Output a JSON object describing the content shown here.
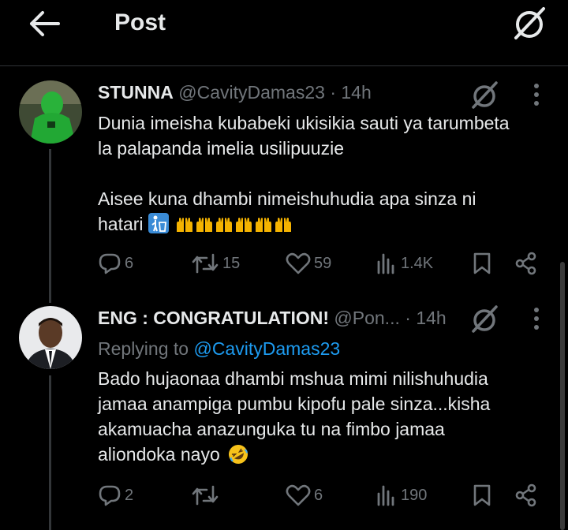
{
  "header": {
    "title": "Post"
  },
  "post": {
    "author_name": "STUNNA",
    "handle": "@CavityDamas23",
    "separator": "·",
    "time": "14h",
    "lines": [
      "Dunia imeisha kubabeki ukisikia sauti ya tarumbeta",
      "la palapanda imelia usilipuuzie"
    ],
    "line3": "Aisee kuna dhambi nimeishuhudia apa sinza ni",
    "line4_text": "hatari",
    "emoji": [
      "litter-in-bin-icon",
      "raising-hands-icon"
    ],
    "stats": {
      "replies": "6",
      "reposts": "15",
      "likes": "59",
      "views": "1.4K"
    }
  },
  "reply": {
    "author_name": "ENG : CONGRATULATION!",
    "handle": "@Pon...",
    "separator": "·",
    "time": "14h",
    "replying_prefix": "Replying to",
    "replying_handle": "@CavityDamas23",
    "lines": [
      "Bado hujaonaa dhambi mshua mimi nilishuhudia",
      "jamaa anampiga pumbu kipofu pale sinza...kisha",
      "akamuacha anazunguka tu na fimbo jamaa",
      "aliondoka nayo"
    ],
    "emoji": [
      "rolling-laughing-icon"
    ],
    "stats": {
      "replies": "2",
      "reposts": "",
      "likes": "6",
      "views": "190"
    }
  },
  "colors": {
    "background": "#000000",
    "text": "#e7e9ea",
    "muted": "#71767b",
    "link": "#1d9bf0",
    "divider": "#2f3336"
  }
}
